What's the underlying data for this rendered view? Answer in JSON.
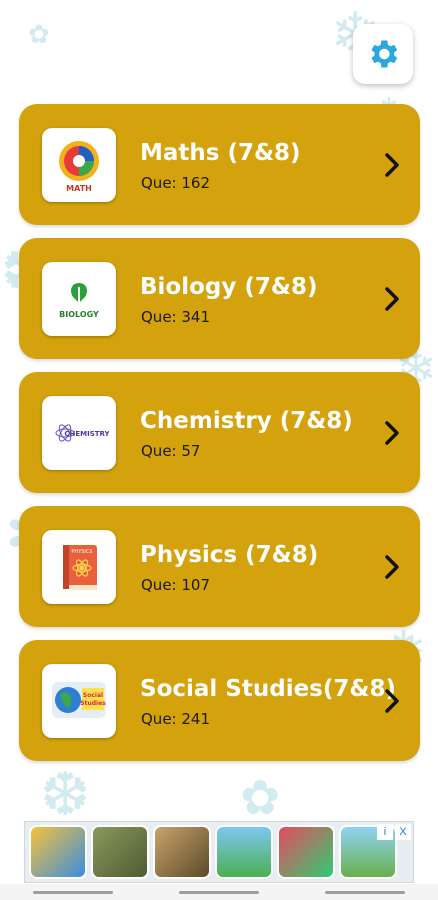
{
  "colors": {
    "card": "#d4a20c",
    "accent": "#2aa7e0",
    "title": "#ffffff"
  },
  "settings": {
    "icon": "gear-icon"
  },
  "subjects": [
    {
      "title": "Maths (7&8)",
      "count": "Que: 162",
      "icon": "maths-logo-icon",
      "logo_text": "MATH"
    },
    {
      "title": "Biology (7&8)",
      "count": "Que: 341",
      "icon": "biology-logo-icon",
      "logo_text": "BIOLOGY"
    },
    {
      "title": "Chemistry (7&8)",
      "count": "Que: 57",
      "icon": "chemistry-logo-icon",
      "logo_text": "CHEMISTRY"
    },
    {
      "title": "Physics (7&8)",
      "count": "Que: 107",
      "icon": "physics-book-icon",
      "logo_text": "PHYSICS"
    },
    {
      "title": "Social Studies(7&8)",
      "count": "Que: 241",
      "icon": "social-studies-globe-icon",
      "logo_text": "Social Studies"
    }
  ],
  "ad": {
    "badges": [
      "i",
      "X"
    ],
    "tiles": [
      "runner-game-icon",
      "tank-game-icon",
      "soldier-game-icon",
      "platform-game-icon",
      "race-game-icon",
      "block-game-icon"
    ]
  }
}
